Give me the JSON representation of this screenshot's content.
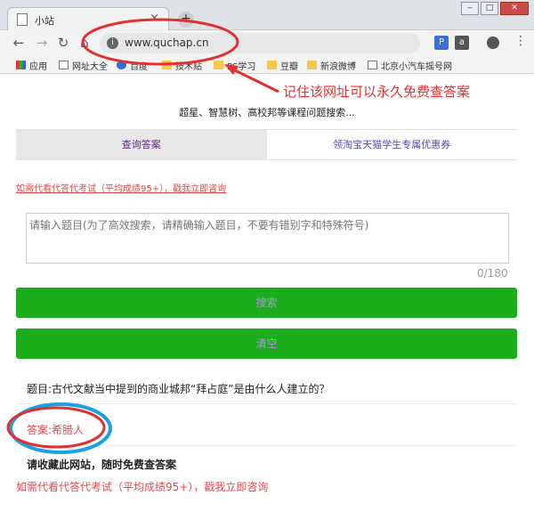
{
  "browser": {
    "tab_title": "小站",
    "tab_close": "×",
    "new_tab": "+",
    "url": "www.quchap.cn",
    "window_buttons": [
      "‒",
      "□",
      "✕"
    ],
    "extension_a": "a",
    "menu": "⋮"
  },
  "bookmarks": [
    {
      "label": "应用",
      "icon": "apps-icon"
    },
    {
      "label": "网址大全",
      "icon": "page-icon"
    },
    {
      "label": "百度",
      "icon": "paw-icon"
    },
    {
      "label": "技术贴",
      "icon": "folder-icon"
    },
    {
      "label": "PS学习",
      "icon": "folder-icon"
    },
    {
      "label": "豆瓣",
      "icon": "folder-icon"
    },
    {
      "label": "新浪微博",
      "icon": "folder-icon"
    },
    {
      "label": "北京小汽车摇号网",
      "icon": "page-icon"
    }
  ],
  "page": {
    "subtitle": "超星、智慧树、高校邦等课程问题搜索...",
    "tabs": [
      "查询答案",
      "领淘宝天猫学生专属优惠券"
    ],
    "promo": "如需代看代答代考试（平均成绩95+），戳我立即咨询",
    "question_placeholder": "请输入题目(为了高效搜索，请精确输入题目，不要有错别字和特殊符号)",
    "counter": "0/180",
    "search_button": "搜索",
    "clear_button": "清空",
    "question": "题目:古代文献当中提到的商业城邦“拜占庭”是由什么人建立的？",
    "answer": "答案:希腊人",
    "bookmark_note": "请收藏此网站，随时免费查答案",
    "promo_bottom": "如需代看代答代考试（平均成绩95+），戳我立即咨询"
  },
  "annotation": {
    "text": "记住该网址可以永久免费查答案",
    "color": "#e53030"
  },
  "colors": {
    "button_green": "#1cad1c",
    "promo_red": "#e74848",
    "highlight_blue": "#1aa0e6"
  }
}
